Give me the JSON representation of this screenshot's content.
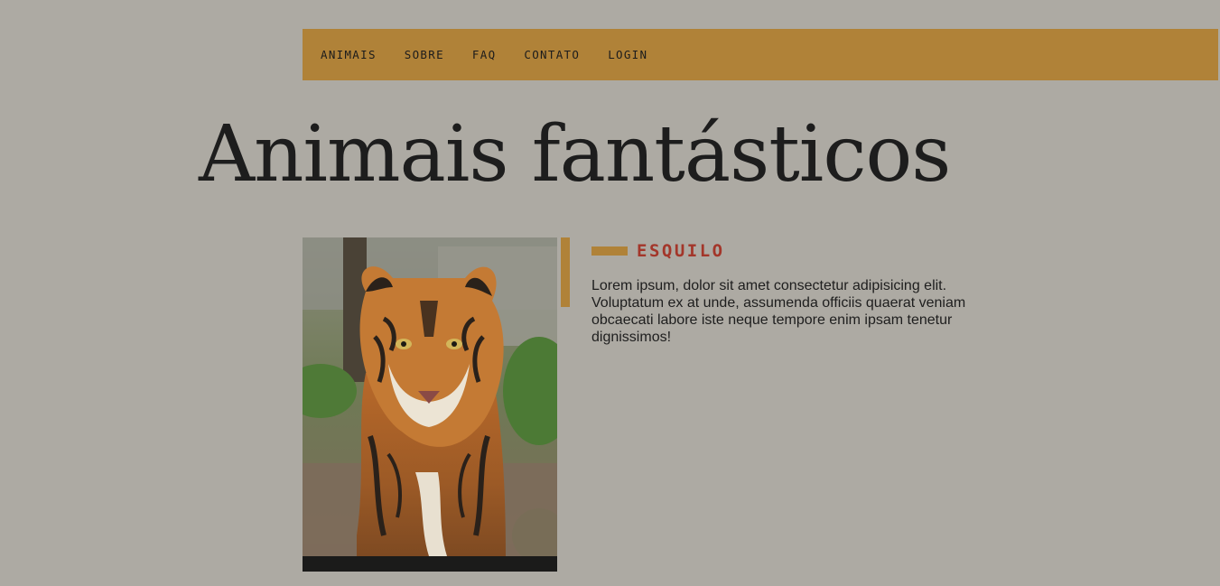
{
  "nav": {
    "items": [
      {
        "label": "ANIMAIS"
      },
      {
        "label": "SOBRE"
      },
      {
        "label": "FAQ"
      },
      {
        "label": "CONTATO"
      },
      {
        "label": "LOGIN"
      }
    ]
  },
  "page": {
    "title": "Animais fantásticos"
  },
  "animal": {
    "name": "ESQUILO",
    "description": "Lorem ipsum, dolor sit amet consectetur adipisicing elit. Voluptatum ex at unde, assumenda officiis quaerat veniam obcaecati labore iste neque tempore enim ipsam tenetur dignissimos!",
    "image_icon": "tiger-photo"
  },
  "colors": {
    "background": "#adaaa3",
    "accent": "#b08238",
    "heading": "#a3362a",
    "text": "#1d1d1d"
  }
}
